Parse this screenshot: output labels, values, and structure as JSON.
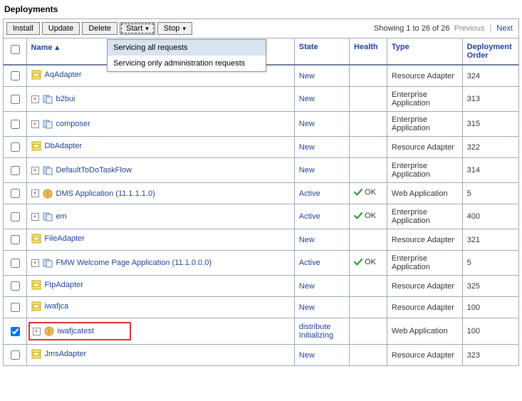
{
  "page": {
    "title": "Deployments"
  },
  "toolbar": {
    "install": "Install",
    "update": "Update",
    "delete": "Delete",
    "start": "Start",
    "stop": "Stop"
  },
  "start_menu": {
    "item1": "Servicing all requests",
    "item2": "Servicing only administration requests"
  },
  "pager": {
    "text": "Showing 1 to 26 of 26",
    "previous": "Previous",
    "next": "Next"
  },
  "columns": {
    "name": "Name",
    "state": "State",
    "health": "Health",
    "type": "Type",
    "deployment_order": "Deployment Order"
  },
  "rows": [
    {
      "checked": false,
      "expandable": false,
      "icon": "connector",
      "name": "AqAdapter",
      "state": "New",
      "health": "",
      "type": "Resource Adapter",
      "order": "324"
    },
    {
      "checked": false,
      "expandable": true,
      "icon": "app",
      "name": "b2bui",
      "state": "New",
      "health": "",
      "type": "Enterprise Application",
      "order": "313"
    },
    {
      "checked": false,
      "expandable": true,
      "icon": "app",
      "name": "composer",
      "state": "New",
      "health": "",
      "type": "Enterprise Application",
      "order": "315"
    },
    {
      "checked": false,
      "expandable": false,
      "icon": "connector",
      "name": "DbAdapter",
      "state": "New",
      "health": "",
      "type": "Resource Adapter",
      "order": "322"
    },
    {
      "checked": false,
      "expandable": true,
      "icon": "app",
      "name": "DefaultToDoTaskFlow",
      "state": "New",
      "health": "",
      "type": "Enterprise Application",
      "order": "314"
    },
    {
      "checked": false,
      "expandable": true,
      "icon": "webapp",
      "name": "DMS Application (11.1.1.1.0)",
      "state": "Active",
      "health": "OK",
      "type": "Web Application",
      "order": "5"
    },
    {
      "checked": false,
      "expandable": true,
      "icon": "app",
      "name": "em",
      "state": "Active",
      "health": "OK",
      "type": "Enterprise Application",
      "order": "400"
    },
    {
      "checked": false,
      "expandable": false,
      "icon": "connector",
      "name": "FileAdapter",
      "state": "New",
      "health": "",
      "type": "Resource Adapter",
      "order": "321"
    },
    {
      "checked": false,
      "expandable": true,
      "icon": "app",
      "name": "FMW Welcome Page Application (11.1.0.0.0)",
      "state": "Active",
      "health": "OK",
      "type": "Enterprise Application",
      "order": "5"
    },
    {
      "checked": false,
      "expandable": false,
      "icon": "connector",
      "name": "FtpAdapter",
      "state": "New",
      "health": "",
      "type": "Resource Adapter",
      "order": "325"
    },
    {
      "checked": false,
      "expandable": false,
      "icon": "connector",
      "name": "iwafjca",
      "state": "New",
      "health": "",
      "type": "Resource Adapter",
      "order": "100"
    },
    {
      "checked": true,
      "expandable": true,
      "icon": "webapp",
      "name": "iwafjcatest",
      "state": "distribute Initializing",
      "health": "",
      "type": "Web Application",
      "order": "100",
      "highlight": true
    },
    {
      "checked": false,
      "expandable": false,
      "icon": "connector",
      "name": "JmsAdapter",
      "state": "New",
      "health": "",
      "type": "Resource Adapter",
      "order": "323"
    }
  ]
}
